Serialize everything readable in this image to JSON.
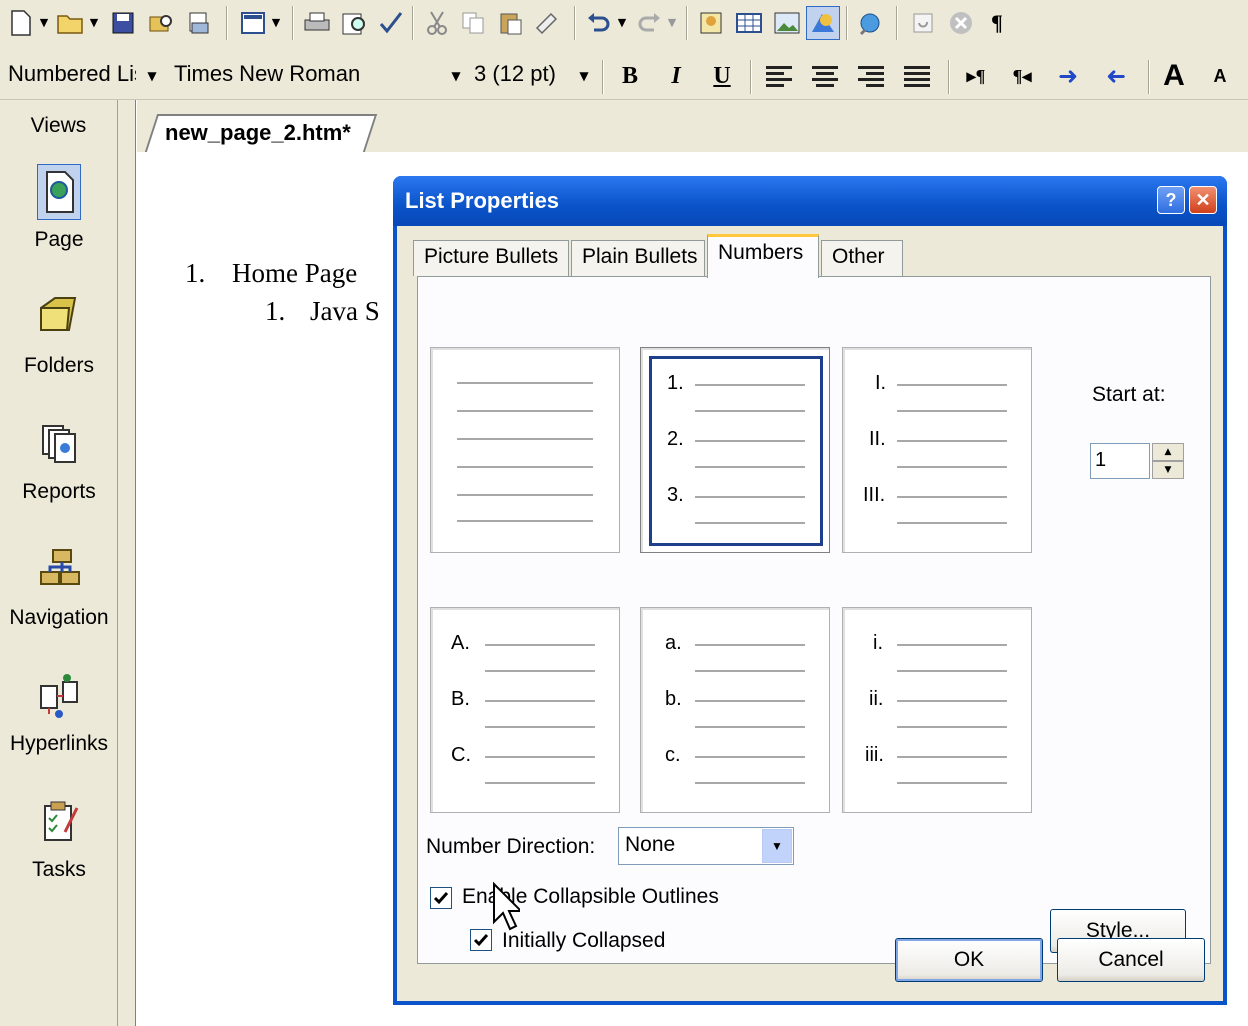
{
  "toolbar": {
    "paragraph_style": "Numbered Lis",
    "font_name": "Times New Roman",
    "font_size": "3 (12 pt)",
    "bold_label": "B",
    "italic_label": "I",
    "underline_label": "U",
    "grow_font_label": "A",
    "shrink_font_label": "A"
  },
  "views": {
    "header": "Views",
    "items": [
      {
        "label": "Page",
        "icon": "page-view-icon"
      },
      {
        "label": "Folders",
        "icon": "folder-icon"
      },
      {
        "label": "Reports",
        "icon": "reports-icon"
      },
      {
        "label": "Navigation",
        "icon": "navigation-icon"
      },
      {
        "label": "Hyperlinks",
        "icon": "hyperlinks-icon"
      },
      {
        "label": "Tasks",
        "icon": "tasks-icon"
      }
    ]
  },
  "document": {
    "tab_title": "new_page_2.htm*",
    "lines": [
      {
        "number": "1.",
        "text": "Home Page"
      },
      {
        "number": "1.",
        "text": "Java S"
      }
    ]
  },
  "dialog": {
    "title": "List Properties",
    "help_label": "?",
    "close_label": "✕",
    "tabs": [
      "Picture Bullets",
      "Plain Bullets",
      "Numbers",
      "Other"
    ],
    "active_tab": "Numbers",
    "styles": [
      {
        "name": "none",
        "markers": [
          "",
          "",
          ""
        ]
      },
      {
        "name": "decimal",
        "markers": [
          "1.",
          "2.",
          "3."
        ]
      },
      {
        "name": "upper-roman",
        "markers": [
          "I.",
          "II.",
          "III."
        ]
      },
      {
        "name": "upper-alpha",
        "markers": [
          "A.",
          "B.",
          "C."
        ]
      },
      {
        "name": "lower-alpha",
        "markers": [
          "a.",
          "b.",
          "c."
        ]
      },
      {
        "name": "lower-roman",
        "markers": [
          "i.",
          "ii.",
          "iii."
        ]
      }
    ],
    "selected_style": "decimal",
    "start_at_label": "Start at:",
    "start_at_value": "1",
    "number_direction_label": "Number Direction:",
    "number_direction_value": "None",
    "enable_collapsible_label": "Enable Collapsible Outlines",
    "enable_collapsible_checked": true,
    "initially_collapsed_label": "Initially Collapsed",
    "initially_collapsed_checked": true,
    "style_button": "Style...",
    "ok_button": "OK",
    "cancel_button": "Cancel"
  },
  "colors": {
    "dialog_title": "#0a53c9",
    "face": "#ece9d8",
    "selected_frame": "#1e3f8c",
    "active_tab_accent": "#ffc83c"
  }
}
